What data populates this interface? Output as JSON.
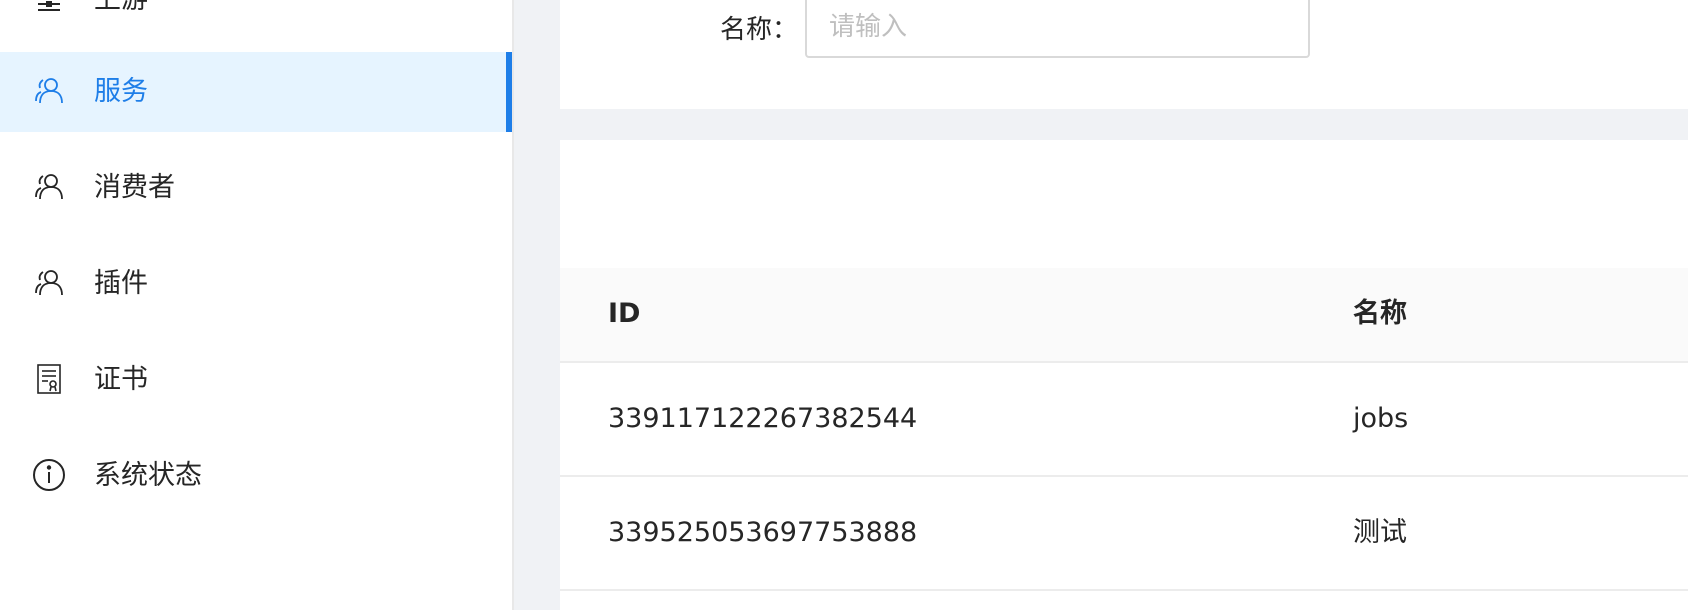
{
  "sidebar": {
    "items": [
      {
        "label": "上游",
        "icon": "upstream-icon",
        "active": false
      },
      {
        "label": "服务",
        "icon": "users-icon",
        "active": true
      },
      {
        "label": "消费者",
        "icon": "users-icon",
        "active": false
      },
      {
        "label": "插件",
        "icon": "users-icon",
        "active": false
      },
      {
        "label": "证书",
        "icon": "certificate-icon",
        "active": false
      },
      {
        "label": "系统状态",
        "icon": "info-circle-icon",
        "active": false
      }
    ]
  },
  "search": {
    "label": "名称：",
    "placeholder": "请输入",
    "value": ""
  },
  "table": {
    "columns": [
      "ID",
      "名称"
    ],
    "rows": [
      {
        "id": "339117122267382544",
        "name": "jobs"
      },
      {
        "id": "339525053697753888",
        "name": "测试"
      }
    ]
  },
  "colors": {
    "accent": "#1e7ee8",
    "active_bg": "#e6f4ff",
    "page_bg": "#f0f2f5"
  }
}
